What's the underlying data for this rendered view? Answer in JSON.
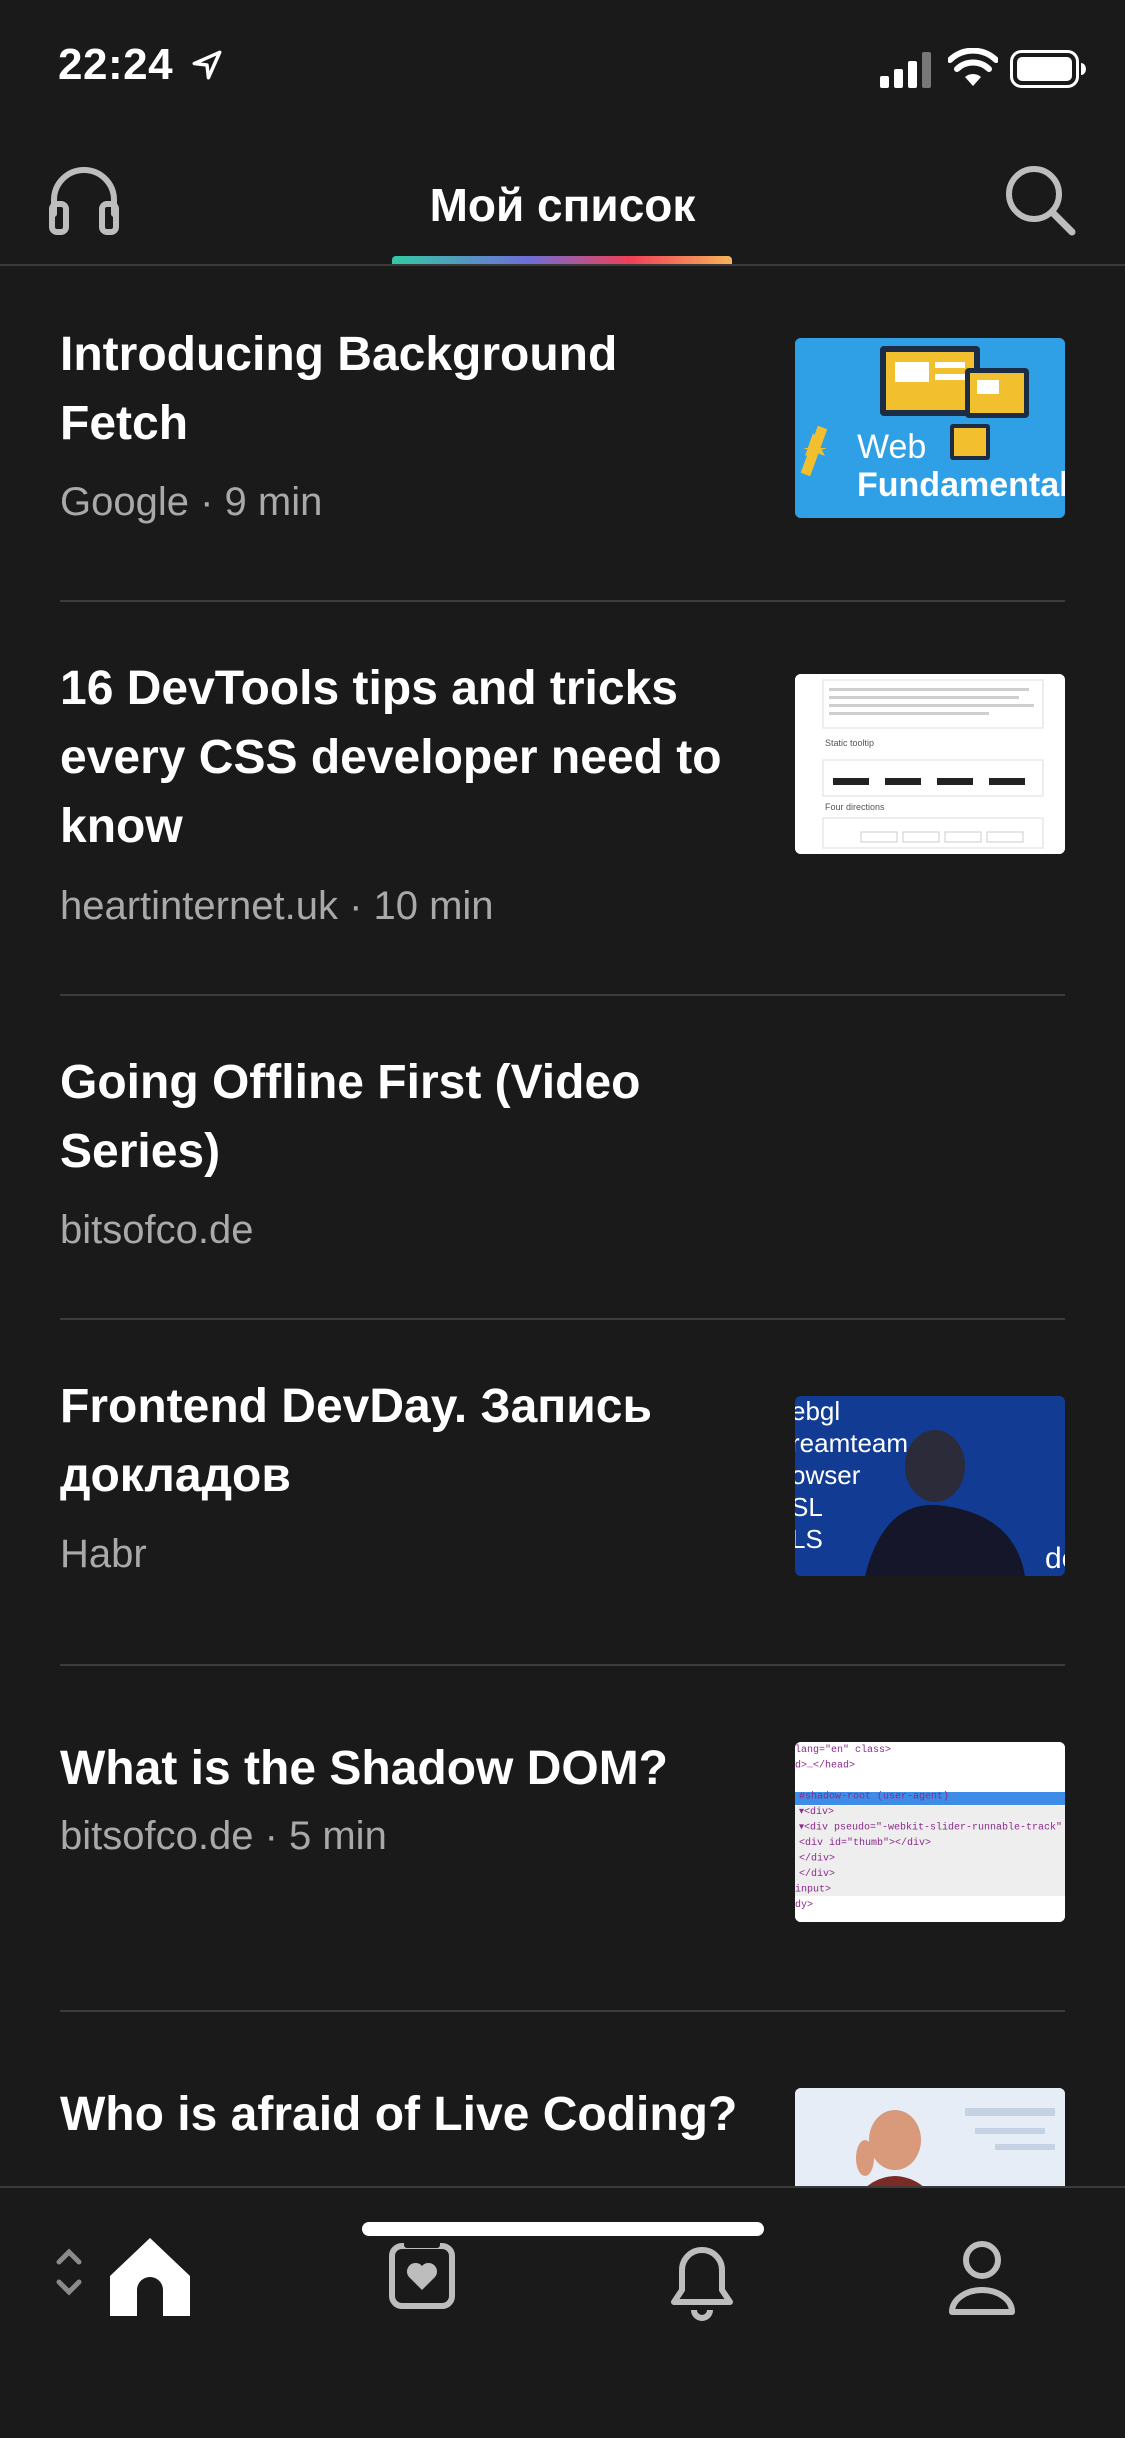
{
  "status_bar": {
    "time": "22:24"
  },
  "header": {
    "title": "Мой список"
  },
  "articles": [
    {
      "title": "Introducing Background Fetch",
      "meta": "Google · 9 min",
      "thumb": "web-fundamentals"
    },
    {
      "title": "16 DevTools tips and tricks every CSS developer need to know",
      "meta": "heartinternet.uk · 10 min",
      "thumb": "tooltips"
    },
    {
      "title": "Going Offline First (Video Series)",
      "meta": "bitsofco.de",
      "thumb": "none"
    },
    {
      "title": "Frontend DevDay. Запись докладов",
      "meta": "Habr",
      "thumb": "conference"
    },
    {
      "title": "What is the Shadow DOM?",
      "meta": "bitsofco.de · 5 min",
      "thumb": "code"
    },
    {
      "title": "Who is afraid of Live Coding?",
      "meta": "",
      "thumb": "speaker"
    }
  ],
  "thumb_text": {
    "web": "Web",
    "fundamentals": "Fundamental",
    "static_tooltip": "Static tooltip",
    "four_directions": "Four directions",
    "conf_lines": [
      "ebgl",
      "reamteam",
      "owser",
      "SL",
      "LS"
    ],
    "code_lines": [
      "lang=\"en\" class>",
      "d>…</head>",
      "put type=\"range\"> == $0",
      "#shadow-root (user-agent)",
      "▾<div>",
      "  ▾<div pseudo=\"-webkit-slider-runnable-track\" id=\"",
      "    <div id=\"thumb\"></div>",
      "  </div>",
      "</div>",
      "input>",
      "dy>"
    ]
  },
  "tab_bar": {
    "tabs": [
      "home",
      "favorites",
      "notifications",
      "profile"
    ],
    "active": "home"
  },
  "colors": {
    "background": "#1a1a1a",
    "text": "#ffffff",
    "meta": "#a9a9a9",
    "divider": "#3c3c3c",
    "accent_gradient": [
      "#35c8a5",
      "#6f6ed8",
      "#ef4056",
      "#f7b45a"
    ]
  }
}
